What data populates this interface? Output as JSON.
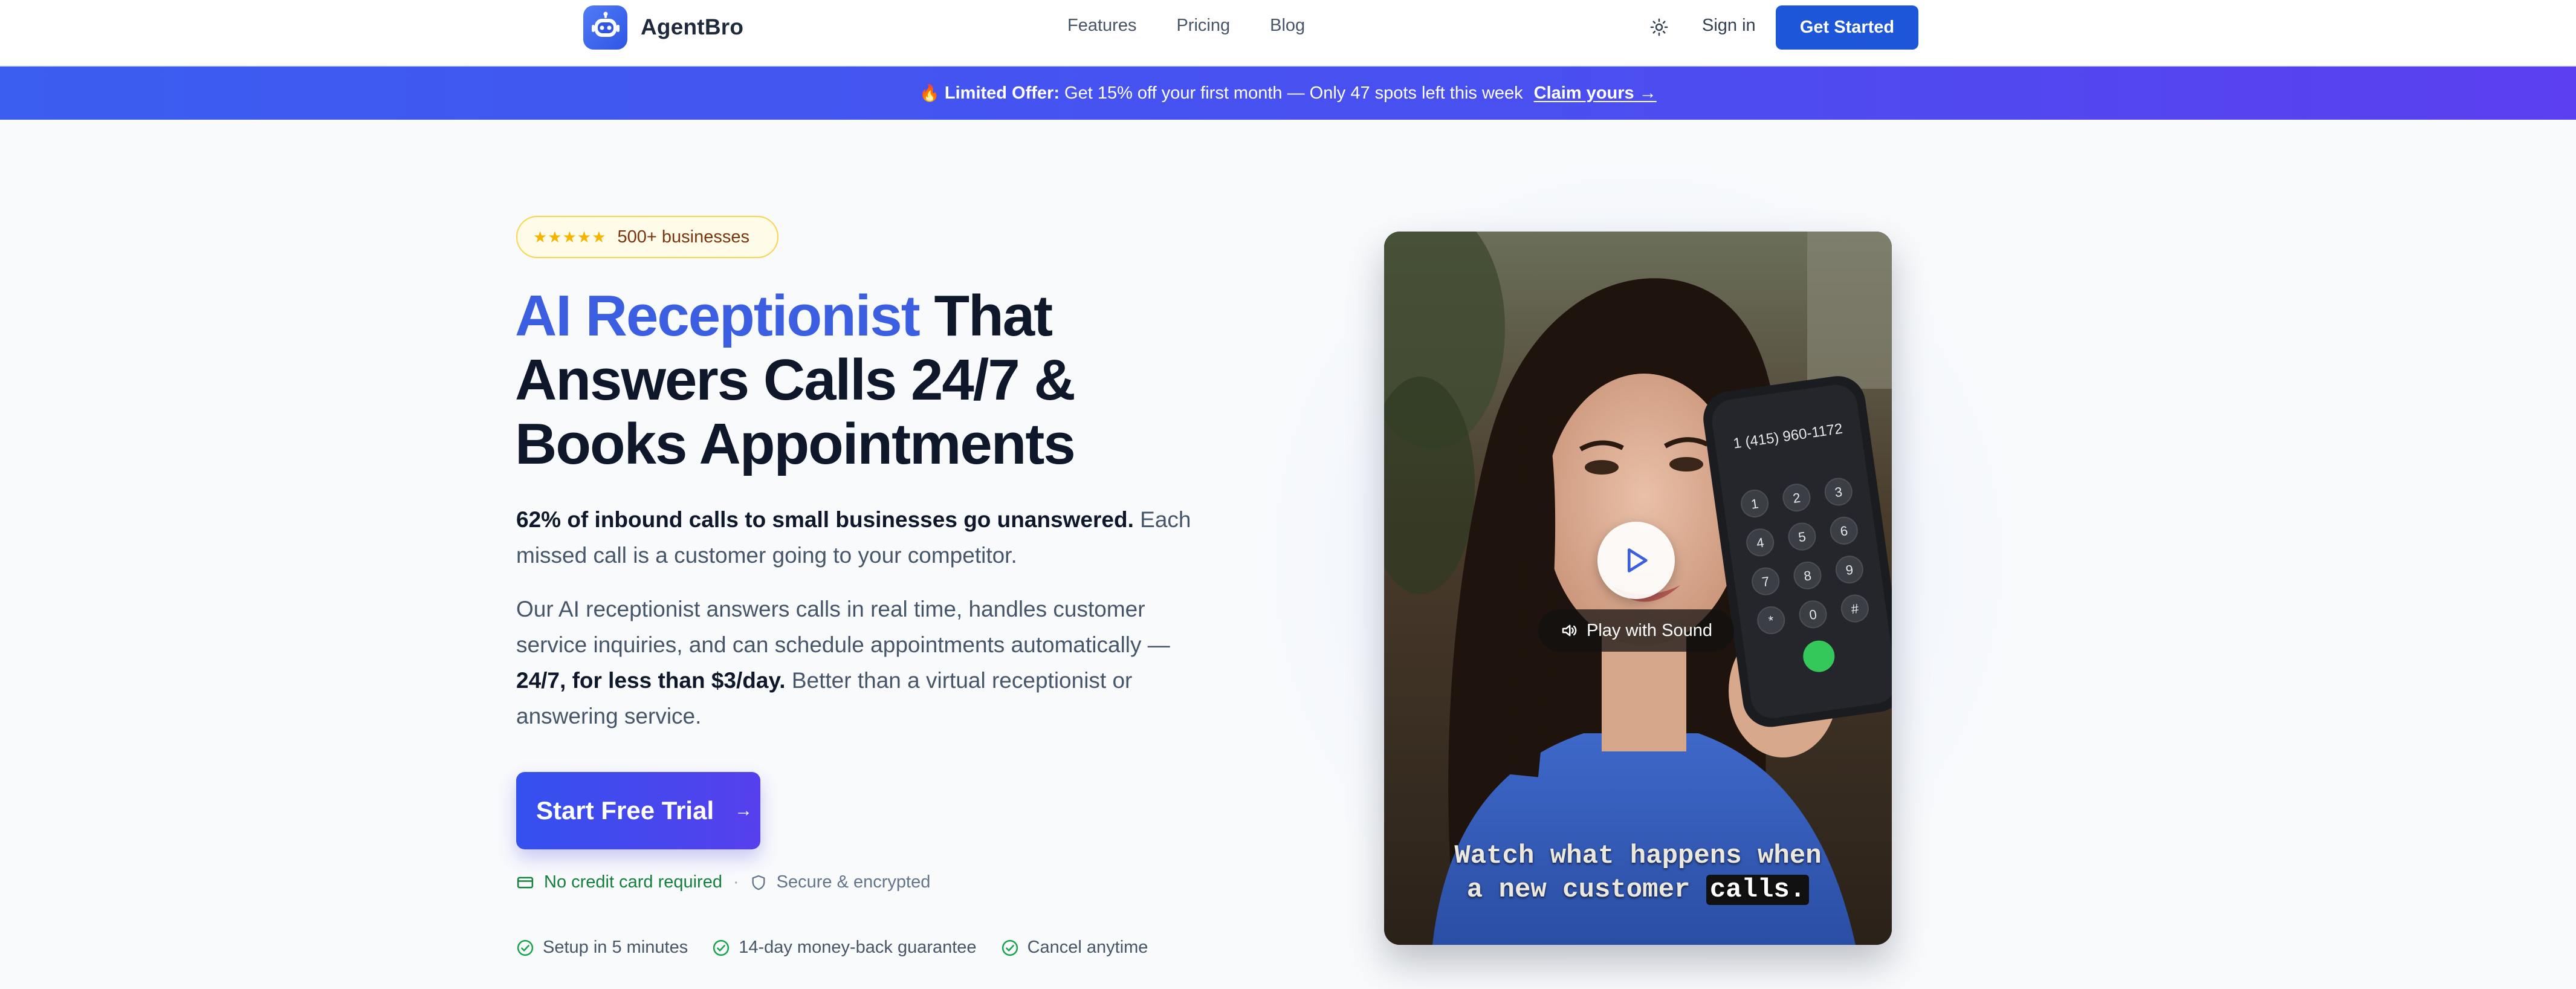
{
  "nav": {
    "brand": "AgentBro",
    "links": [
      "Features",
      "Pricing",
      "Blog"
    ],
    "theme_icon": "sun-icon",
    "signin": "Sign in",
    "cta": "Get Started"
  },
  "promo": {
    "emoji": "🔥",
    "label": "Limited Offer:",
    "text": "Get 15% off your first month — Only 47 spots left this week",
    "link": "Claim yours →"
  },
  "hero": {
    "rating_stars": "★★★★★",
    "rating_text": "500+ businesses",
    "headline_accent": "AI Receptionist",
    "headline_line1_rest": "That",
    "headline_line2": "Answers Calls 24/7 &",
    "headline_line3": "Books Appointments",
    "para1_bold": "62% of inbound calls to small businesses go unanswered.",
    "para1_rest": "Each missed call is a customer going to your competitor.",
    "para2_start": "Our AI receptionist answers calls in real time, handles customer service inquiries, and can schedule appointments automatically —",
    "para2_bold": "24/7, for less than $3/day.",
    "para2_end": "Better than a virtual receptionist or answering service.",
    "cta": "Start Free Trial",
    "cta_arrow": "→",
    "trust_no_card": "No credit card required",
    "trust_dot": "·",
    "trust_secure": "Secure & encrypted",
    "bullets": [
      "Setup in 5 minutes",
      "14-day money-back guarantee",
      "Cancel anytime"
    ]
  },
  "video": {
    "phone_number": "1 (415) 960-1172",
    "play_label": "Play with Sound",
    "caption_line1": "Watch what happens when",
    "caption_line2_start": "a new customer",
    "caption_highlight": "calls."
  },
  "colors": {
    "accent": "#3b5fe0",
    "primary_button": "#1d56d8",
    "promo_start": "#3b5df0",
    "promo_end": "#5b3ff0",
    "success": "#15803d"
  }
}
